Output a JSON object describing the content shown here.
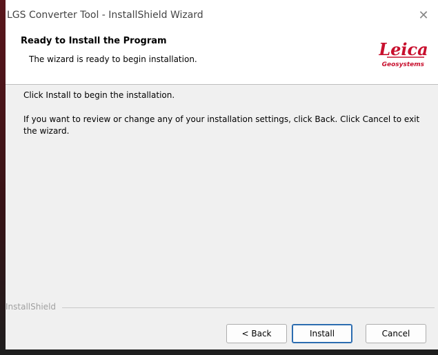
{
  "window": {
    "title": "LGS Converter Tool - InstallShield Wizard",
    "close_glyph": "✕"
  },
  "header": {
    "title": "Ready to Install the Program",
    "subtitle": "The wizard is ready to begin installation.",
    "logo": {
      "brand": "Leica",
      "tagline": "Geosystems",
      "color": "#c8102e"
    }
  },
  "body": {
    "line1": "Click Install to begin the installation.",
    "line2": "If you want to review or change any of your installation settings, click Back. Click Cancel to exit the wizard."
  },
  "footer": {
    "brand_label": "InstallShield",
    "buttons": {
      "back": "< Back",
      "install": "Install",
      "cancel": "Cancel"
    }
  },
  "colors": {
    "accent_button_border": "#2b6cb0",
    "panel_bg": "#f0f0f0"
  }
}
